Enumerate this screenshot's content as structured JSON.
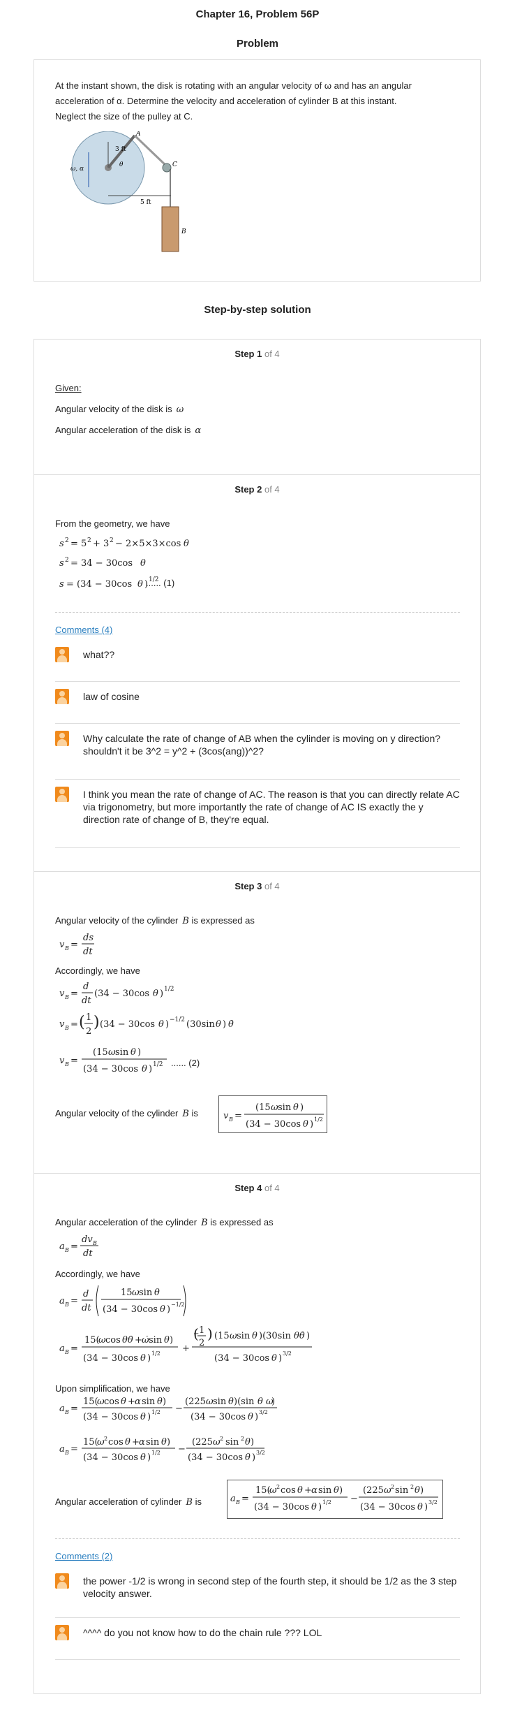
{
  "header": {
    "title": "Chapter 16, Problem 56P"
  },
  "problem": {
    "heading": "Problem",
    "statement_line1": "At the instant shown, the disk is rotating with an angular velocity of ω and has an angular",
    "statement_line2": "acceleration of α. Determine the velocity and acceleration of cylinder B at this instant.",
    "statement_line3": "Neglect the size of the pulley at C.",
    "figure": {
      "label_omega_alpha": "ω, α",
      "label_3ft": "3 ft",
      "label_theta": "θ",
      "label_A": "A",
      "label_C": "C",
      "label_5ft": "5 ft",
      "label_B": "B"
    }
  },
  "solution": {
    "heading": "Step-by-step solution",
    "steps": [
      {
        "label": "Step 1",
        "of": "of 4",
        "given": "Given:",
        "line1": "Angular velocity of the disk is",
        "sym1": "ω",
        "line2": "Angular acceleration of the disk is",
        "sym2": "α"
      },
      {
        "label": "Step 2",
        "of": "of 4",
        "intro": "From the geometry, we have",
        "eq_tag": "...... (1)",
        "comments_link": "Comments (4)",
        "comments": [
          "what??",
          "law of cosine",
          "Why calculate the rate of change of AB when the cylinder is moving on y direction? shouldn't it be 3^2 = y^2 + (3cos(ang))^2?",
          "I think you mean the rate of change of AC. The reason is that you can directly relate AC via trigonometry, but more importantly the rate of change of AC IS exactly the y direction rate of change of B, they're equal."
        ]
      },
      {
        "label": "Step 3",
        "of": "of 4",
        "intro": "Angular velocity of the cylinder",
        "sym": "B",
        "intro_tail": "is expressed as",
        "accordingly": "Accordingly, we have",
        "eq_tag": "...... (2)",
        "result_text": "Angular velocity of the cylinder",
        "result_sym": "B",
        "result_is": "is"
      },
      {
        "label": "Step 4",
        "of": "of 4",
        "intro": "Angular acceleration of the cylinder",
        "sym": "B",
        "intro_tail": "is expressed as",
        "accordingly": "Accordingly, we have",
        "simplification": "Upon simplification, we have",
        "result_text": "Angular acceleration of cylinder",
        "result_sym": "B",
        "result_is": "is",
        "comments_link": "Comments (2)",
        "comments": [
          "the power -1/2 is wrong in second step of the fourth step, it should be 1/2 as the 3 step velocity answer.",
          "^^^^ do you not know how to do the chain rule ??? LOL"
        ]
      }
    ]
  }
}
